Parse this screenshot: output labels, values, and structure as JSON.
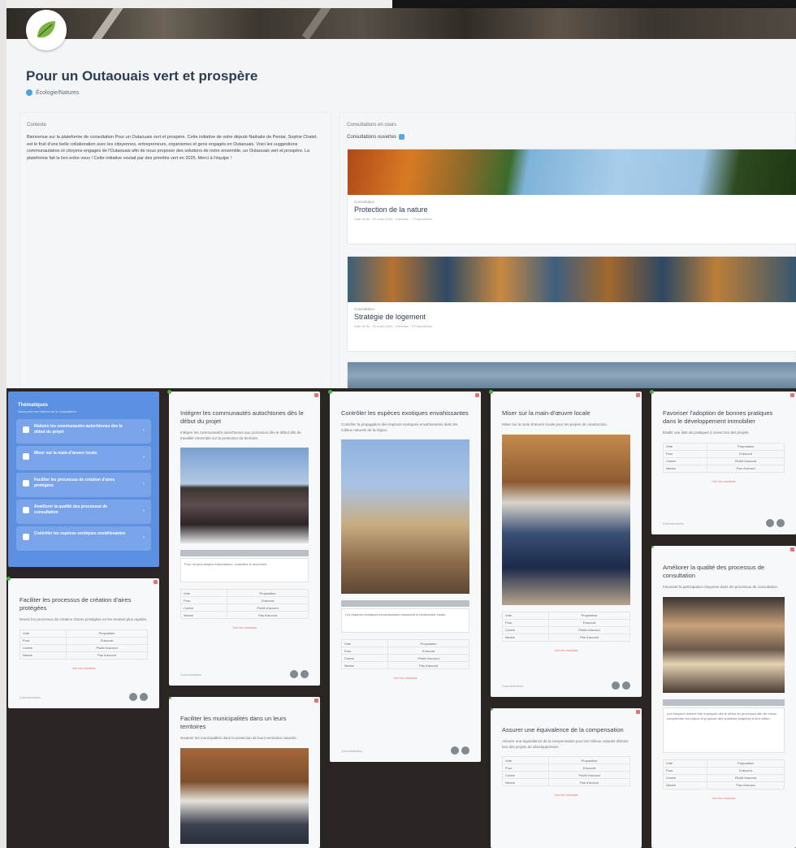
{
  "site": {
    "logo_name": "Nature Outaouais logo",
    "title": "Pour un Outaouais vert et prospère",
    "owner": "Écologie/Natures"
  },
  "left_panel": {
    "label": "Contexte",
    "description": "Bienvenue sur la plateforme de consultation Pour un Outaouais vert et prospère. Cette initiative de votre député Nathalie de Pentar, Sophie Chatel, est le fruit d'une belle collaboration avec les citoyennes, entrepreneurs, organismes et gens engagés en Outaouais. Voici les suggestions communautaires et citoyens engagés de l'Outaouais afin de nous proposer des solutions de notre ensemble, un Outaouais vert et prospère. La plateforme fait le lien entre vous ! Cette initiative voulait par des priorités vert en 2025. Merci à l'équipe !"
  },
  "right_panel": {
    "label": "Consultations en cours",
    "sublabel": "Consultations ouvertes",
    "consultations": [
      {
        "tag": "Consultation",
        "name": "Protection de la nature",
        "meta": "Date de fin : 31 mars 2024 · 4 thèmes · 7 Propositions"
      },
      {
        "tag": "Consultation",
        "name": "Stratégie de logement",
        "meta": "Date de fin : 31 mars 2024 · 5 thèmes · 9 Propositions"
      },
      {
        "tag": "Consultation",
        "name": "",
        "meta": ""
      }
    ]
  },
  "board": {
    "topics": {
      "title": "Thématiques",
      "subtitle": "Découvrez les thèmes de la consultation",
      "items": [
        "Réduire les communautés autochtones dès le début du projet",
        "Miser sur la main-d'œuvre locale",
        "Faciliter les processus de création d'aires protégées",
        "Améliorer la qualité des processus de consultation",
        "Contrôler les espèces exotiques envahissantes"
      ]
    },
    "cards": [
      {
        "title": "Faciliter les processus de création d'aires protégées",
        "text": "Revoir les processus de création d'aires protégées en les rendant plus rapides.",
        "rows": [
          [
            "Vote",
            "Proposition"
          ],
          [
            "Pour",
            "D'accord"
          ],
          [
            "Contre",
            "Plutôt d'accord"
          ],
          [
            "Neutre",
            "Pas d'accord"
          ]
        ],
        "vote": "Voir les résultats",
        "footer": "Commentaires"
      },
      {
        "title": "Intégrer les communautés autochtones dès le début du projet",
        "text": "Intégrer les communautés autochtones aux processus dès le début afin de travailler ensemble sur la protection du territoire.",
        "caption": "Pour de plus amples informations, consultez le document.",
        "rows": [
          [
            "Vote",
            "Proposition"
          ],
          [
            "Pour",
            "D'accord"
          ],
          [
            "Contre",
            "Plutôt d'accord"
          ],
          [
            "Neutre",
            "Pas d'accord"
          ]
        ],
        "vote": "Voir les résultats",
        "footer": "Commentaires"
      },
      {
        "title": "Faciliter les municipalités dans un leurs territoires",
        "text": "Soutenir les municipalités dans la protection de leurs territoires naturels."
      },
      {
        "title": "Contrôler les espèces exotiques envahissantes",
        "text": "Contrôler la propagation des espèces exotiques envahissantes dans les milieux naturels de la région.",
        "caption": "Les espèces exotiques envahissantes menacent la biodiversité locale.",
        "rows": [
          [
            "Vote",
            "Proposition"
          ],
          [
            "Pour",
            "D'accord"
          ],
          [
            "Contre",
            "Plutôt d'accord"
          ],
          [
            "Neutre",
            "Pas d'accord"
          ]
        ],
        "vote": "Voir les résultats",
        "footer": "Commentaires"
      },
      {
        "title": "Miser sur la main-d'œuvre locale",
        "text": "Miser sur la main-d'œuvre locale pour les projets de construction.",
        "rows": [
          [
            "Vote",
            "Proposition"
          ],
          [
            "Pour",
            "D'accord"
          ],
          [
            "Contre",
            "Plutôt d'accord"
          ],
          [
            "Neutre",
            "Pas d'accord"
          ]
        ],
        "vote": "Voir les résultats",
        "footer": "Commentaires"
      },
      {
        "title": "Assurer une équivalence de la compensation",
        "text": "Assurer une équivalence de la compensation pour les milieux naturels détruits lors des projets de développement.",
        "rows": [
          [
            "Vote",
            "Proposition"
          ],
          [
            "Pour",
            "D'accord"
          ],
          [
            "Contre",
            "Plutôt d'accord"
          ],
          [
            "Neutre",
            "Pas d'accord"
          ]
        ],
        "vote": "Voir les résultats"
      },
      {
        "title": "Favoriser l'adoption de bonnes pratiques dans le développement immobilier",
        "text": "Établir une liste de pratiques à suivre lors des projets.",
        "rows": [
          [
            "Vote",
            "Proposition"
          ],
          [
            "Pour",
            "D'accord"
          ],
          [
            "Contre",
            "Plutôt d'accord"
          ],
          [
            "Neutre",
            "Pas d'accord"
          ]
        ],
        "vote": "Voir les résultats",
        "footer": "Commentaires"
      },
      {
        "title": "Améliorer la qualité des processus de consultation",
        "text": "Favoriser la participation citoyenne dans les processus de consultation.",
        "caption": "Les citoyens doivent être impliqués dès le début du processus afin de mieux comprendre les enjeux et proposer des solutions adaptées à leur milieu.",
        "rows": [
          [
            "Vote",
            "Proposition"
          ],
          [
            "Pour",
            "D'accord"
          ],
          [
            "Contre",
            "Plutôt d'accord"
          ],
          [
            "Neutre",
            "Pas d'accord"
          ]
        ],
        "vote": "Voir les résultats"
      }
    ]
  }
}
